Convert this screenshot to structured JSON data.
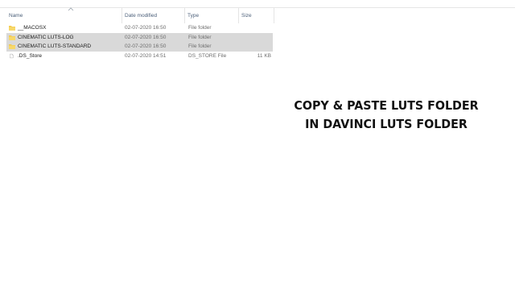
{
  "explorer": {
    "columns": {
      "name": "Name",
      "date_modified": "Date modified",
      "type": "Type",
      "size": "Size"
    },
    "rows": [
      {
        "name": "__MACOSX",
        "date": "02-07-2020 16:50",
        "type": "File folder",
        "size": "",
        "icon": "folder-icon",
        "selected": false
      },
      {
        "name": "CINEMATIC LUTS-LOG",
        "date": "02-07-2020 16:50",
        "type": "File folder",
        "size": "",
        "icon": "folder-icon",
        "selected": true
      },
      {
        "name": "CINEMATIC LUTS-STANDARD",
        "date": "02-07-2020 16:50",
        "type": "File folder",
        "size": "",
        "icon": "folder-icon",
        "selected": true
      },
      {
        "name": ".DS_Store",
        "date": "02-07-2020 14:51",
        "type": "DS_STORE File",
        "size": "11 KB",
        "icon": "file-icon",
        "selected": false
      }
    ],
    "sort_icon": "sort-up-icon"
  },
  "banner": {
    "line1": "COPY & PASTE LUTS FOLDER",
    "line2": "IN DAVINCI LUTS FOLDER"
  },
  "colors": {
    "folder": "#f2c94c",
    "selection": "#d9d9d9",
    "header_text": "#4c607a"
  }
}
